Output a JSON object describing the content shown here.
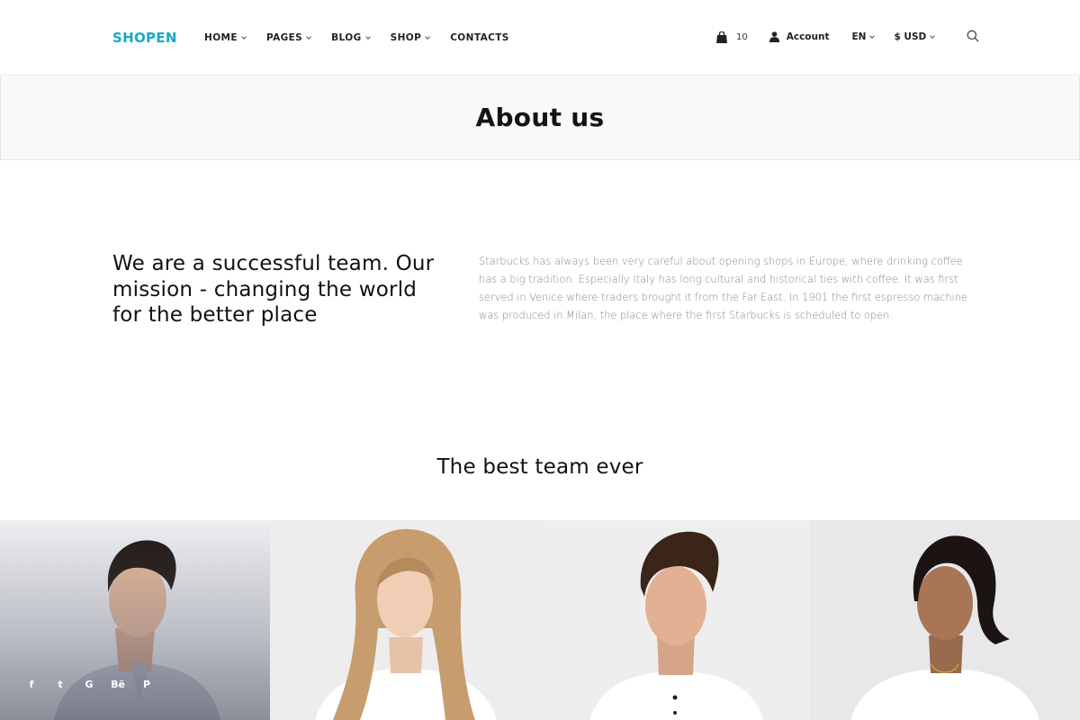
{
  "brand": {
    "name": "SHOPEN",
    "accent": "#17a9c6"
  },
  "nav": [
    {
      "label": "HOME",
      "has_dropdown": true
    },
    {
      "label": "PAGES",
      "has_dropdown": true
    },
    {
      "label": "BLOG",
      "has_dropdown": true
    },
    {
      "label": "SHOP",
      "has_dropdown": true
    },
    {
      "label": "CONTACTS",
      "has_dropdown": false
    }
  ],
  "toolbar": {
    "cart_count": "10",
    "account_label": "Account",
    "language": "EN",
    "currency": "$ USD",
    "icons": [
      "cart-icon",
      "user-icon",
      "search-icon"
    ]
  },
  "page": {
    "title": "About us"
  },
  "mission": {
    "heading": "We are a successful team. Our mission - changing the world for the better place",
    "text": "Starbucks has always been very careful about opening shops in Europe, where drinking coffee has a big tradition. Especially Italy has long cultural and historical ties with coffee. It was first served in Venice where traders brought it from the Far East. In 1901 the first espresso machine was produced in Milan, the place where the first Starbucks is scheduled to open."
  },
  "team": {
    "title": "The best team ever",
    "members": [
      {
        "photo": "man-dark-hair-portrait",
        "socials": [
          "f",
          "t",
          "G",
          "Bē",
          "P"
        ]
      },
      {
        "photo": "woman-blonde-hair-portrait"
      },
      {
        "photo": "man-brown-hair-portrait"
      },
      {
        "photo": "woman-dark-hair-portrait"
      }
    ]
  }
}
